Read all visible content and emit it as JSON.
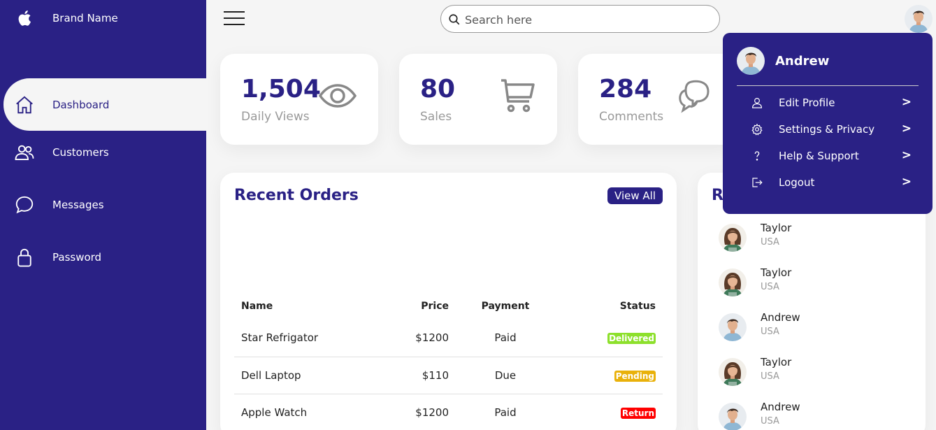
{
  "brand": {
    "name": "Brand Name",
    "icon": "apple-icon"
  },
  "sidebar": {
    "items": [
      {
        "label": "Dashboard",
        "icon": "home-icon",
        "active": true
      },
      {
        "label": "Customers",
        "icon": "people-icon"
      },
      {
        "label": "Messages",
        "icon": "chat-icon"
      },
      {
        "label": "Password",
        "icon": "lock-icon"
      }
    ]
  },
  "topbar": {
    "search_placeholder": "Search here"
  },
  "cards": [
    {
      "number": "1,504",
      "caption": "Daily Views",
      "icon": "eye-icon"
    },
    {
      "number": "80",
      "caption": "Sales",
      "icon": "cart-icon"
    },
    {
      "number": "284",
      "caption": "Comments",
      "icon": "chat-bubbles-icon"
    }
  ],
  "orders": {
    "title": "Recent Orders",
    "view_all": "View All",
    "headers": [
      "Name",
      "Price",
      "Payment",
      "Status"
    ],
    "rows": [
      {
        "name": "Star Refrigator",
        "price": "$1200",
        "payment": "Paid",
        "status": "Delivered"
      },
      {
        "name": "Dell Laptop",
        "price": "$110",
        "payment": "Due",
        "status": "Pending"
      },
      {
        "name": "Apple Watch",
        "price": "$1200",
        "payment": "Paid",
        "status": "Return"
      }
    ],
    "status_colors": {
      "Delivered": "#8de02c",
      "Pending": "#e9b10a",
      "Return": "#f00"
    }
  },
  "customers": {
    "title_visible": "R",
    "list": [
      {
        "name": "Taylor",
        "country": "USA"
      },
      {
        "name": "Taylor",
        "country": "USA"
      },
      {
        "name": "Andrew",
        "country": "USA"
      },
      {
        "name": "Taylor",
        "country": "USA"
      },
      {
        "name": "Andrew",
        "country": "USA"
      }
    ]
  },
  "profile_menu": {
    "user": "Andrew",
    "items": [
      {
        "label": "Edit Profile",
        "icon": "user-icon",
        "arrow": ">"
      },
      {
        "label": "Settings & Privacy",
        "icon": "gear-icon",
        "arrow": ">"
      },
      {
        "label": "Help & Support",
        "icon": "question-icon",
        "arrow": ">"
      },
      {
        "label": "Logout",
        "icon": "logout-icon",
        "arrow": ">"
      }
    ]
  },
  "colors": {
    "primary": "#2a2185",
    "background": "#f5f5f5",
    "muted": "#999999"
  }
}
